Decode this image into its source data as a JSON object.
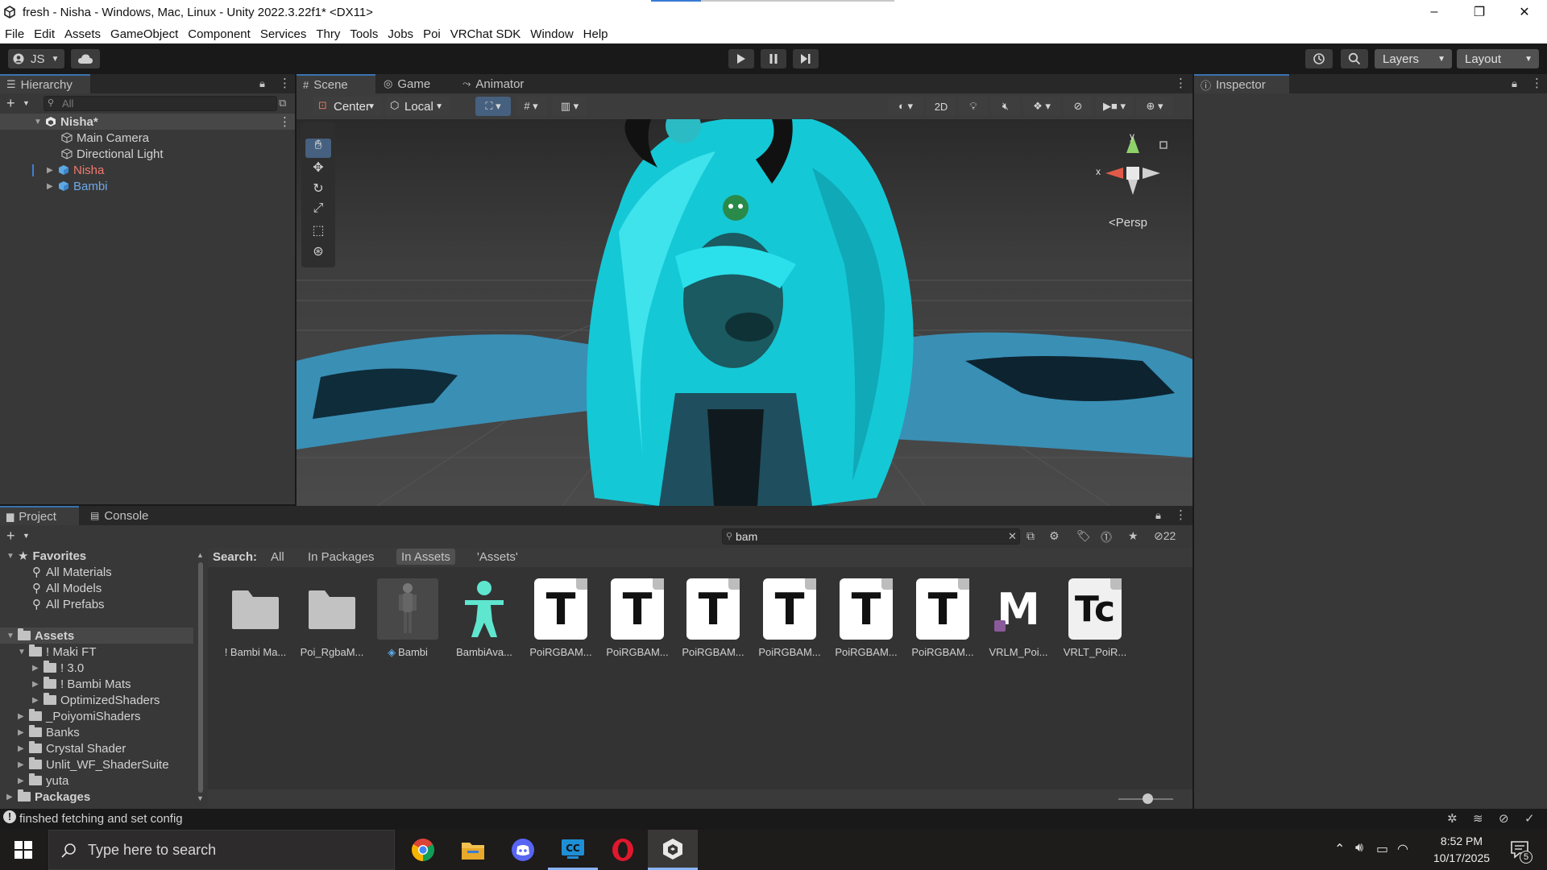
{
  "window": {
    "title": "fresh - Nisha - Windows, Mac, Linux - Unity 2022.3.22f1* <DX11>",
    "minimize": "–",
    "restore": "❐",
    "close": "✕"
  },
  "menu": [
    "File",
    "Edit",
    "Assets",
    "GameObject",
    "Component",
    "Services",
    "Thry",
    "Tools",
    "Jobs",
    "Poi",
    "VRChat SDK",
    "Window",
    "Help"
  ],
  "toolbar": {
    "account": "JS",
    "layers": "Layers",
    "layout": "Layout"
  },
  "hierarchy": {
    "tab": "Hierarchy",
    "search_placeholder": "All",
    "scene": "Nisha*",
    "items": [
      {
        "label": "Main Camera",
        "color": "#d2d2d2"
      },
      {
        "label": "Directional Light",
        "color": "#d2d2d2"
      },
      {
        "label": "Nisha",
        "color": "#f07a6e"
      },
      {
        "label": "Bambi",
        "color": "#6fa8e8"
      }
    ]
  },
  "scene_tabs": [
    "Scene",
    "Game",
    "Animator"
  ],
  "scene_toolbar": {
    "pivot": "Center",
    "space": "Local",
    "mode_2d": "2D"
  },
  "gizmo": {
    "x": "x",
    "y": "y",
    "projection": "Persp"
  },
  "inspector": {
    "tab": "Inspector"
  },
  "project": {
    "tabs": [
      "Project",
      "Console"
    ],
    "search_value": "bam",
    "hidden_count": "22",
    "search_label": "Search:",
    "filters": [
      "All",
      "In Packages",
      "In Assets",
      "'Assets'"
    ],
    "favorites_label": "Favorites",
    "favorites": [
      "All Materials",
      "All Models",
      "All Prefabs"
    ],
    "assets_label": "Assets",
    "tree": [
      {
        "label": "! Maki FT",
        "depth": 1,
        "open": true
      },
      {
        "label": "! 3.0",
        "depth": 2,
        "open": false
      },
      {
        "label": "! Bambi Mats",
        "depth": 2,
        "open": false
      },
      {
        "label": "OptimizedShaders",
        "depth": 2,
        "open": false
      },
      {
        "label": "_PoiyomiShaders",
        "depth": 1,
        "open": false
      },
      {
        "label": "Banks",
        "depth": 1,
        "open": false
      },
      {
        "label": "Crystal Shader",
        "depth": 1,
        "open": false
      },
      {
        "label": "Unlit_WF_ShaderSuite",
        "depth": 1,
        "open": false
      },
      {
        "label": "yuta",
        "depth": 1,
        "open": false
      }
    ],
    "packages_label": "Packages",
    "assets": [
      {
        "label": "! Bambi Ma...",
        "kind": "folder"
      },
      {
        "label": "Poi_RgbaM...",
        "kind": "folder"
      },
      {
        "label": "Bambi",
        "kind": "prefab"
      },
      {
        "label": "BambiAva...",
        "kind": "avatar"
      },
      {
        "label": "PoiRGBAM...",
        "kind": "text"
      },
      {
        "label": "PoiRGBAM...",
        "kind": "text"
      },
      {
        "label": "PoiRGBAM...",
        "kind": "text"
      },
      {
        "label": "PoiRGBAM...",
        "kind": "text"
      },
      {
        "label": "PoiRGBAM...",
        "kind": "text"
      },
      {
        "label": "PoiRGBAM...",
        "kind": "text"
      },
      {
        "label": "VRLM_Poi...",
        "kind": "material"
      },
      {
        "label": "VRLT_PoiR...",
        "kind": "textcore"
      }
    ],
    "icon_letters": {
      "text": "T",
      "material": "M",
      "textcore": "Tc"
    }
  },
  "status": {
    "message": "finshed fetching and set config"
  },
  "taskbar": {
    "search_placeholder": "Type here to search",
    "time": "8:52 PM",
    "date": "10/17/2025",
    "notifications": "5"
  }
}
